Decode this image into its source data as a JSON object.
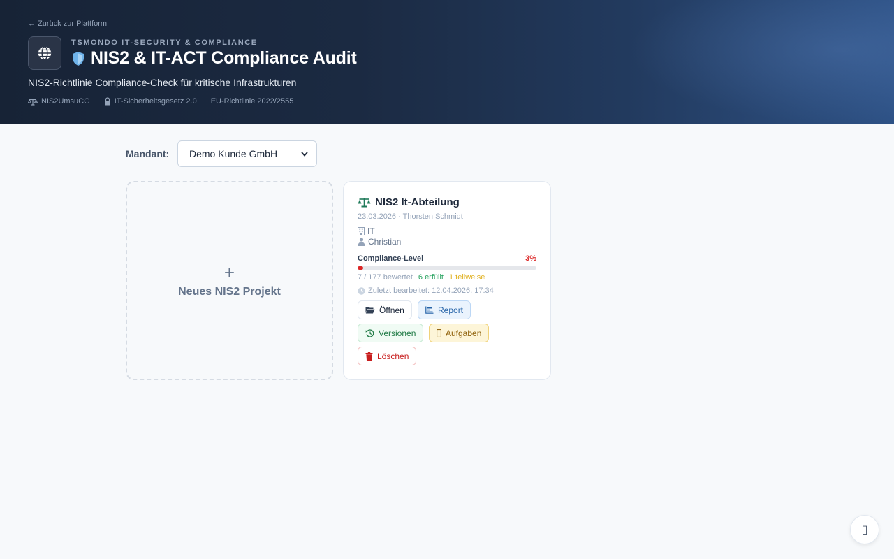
{
  "header": {
    "back_link": "← Zurück zur Plattform",
    "overline": "TSMONDO IT-SECURITY & COMPLIANCE",
    "title": "NIS2 & IT-ACT Compliance Audit",
    "subtitle": "NIS2-Richtlinie Compliance-Check für kritische Infrastrukturen",
    "tags": [
      {
        "label": "NIS2UmsuCG",
        "icon": "scale-icon"
      },
      {
        "label": "IT-Sicherheitsgesetz 2.0",
        "icon": "lock-icon"
      },
      {
        "label": "EU-Richtlinie 2022/2555",
        "icon": ""
      }
    ]
  },
  "mandant": {
    "label": "Mandant:",
    "selected": "Demo Kunde GmbH"
  },
  "new_project": {
    "plus": "+",
    "label": "Neues NIS2 Projekt"
  },
  "project": {
    "title": "NIS2 It-Abteilung",
    "meta": "23.03.2026 · Thorsten Schmidt",
    "department": "IT",
    "owner": "Christian",
    "level_label": "Compliance-Level",
    "level_pct": "3%",
    "level_value": 3,
    "evaluated": "7 / 177 bewertet",
    "fulfilled": "6 erfüllt",
    "partial": "1 teilweise",
    "last_edit": "Zuletzt bearbeitet: 12.04.2026, 17:34",
    "buttons": {
      "open": "Öffnen",
      "report": "Report",
      "versions": "Versionen",
      "tasks": "Aufgaben",
      "delete": "Löschen"
    }
  },
  "fab": {
    "glyph": "▯"
  },
  "colors": {
    "danger": "#dc2626",
    "success": "#22a05b",
    "warning": "#e0b020",
    "info": "#2563a8"
  }
}
